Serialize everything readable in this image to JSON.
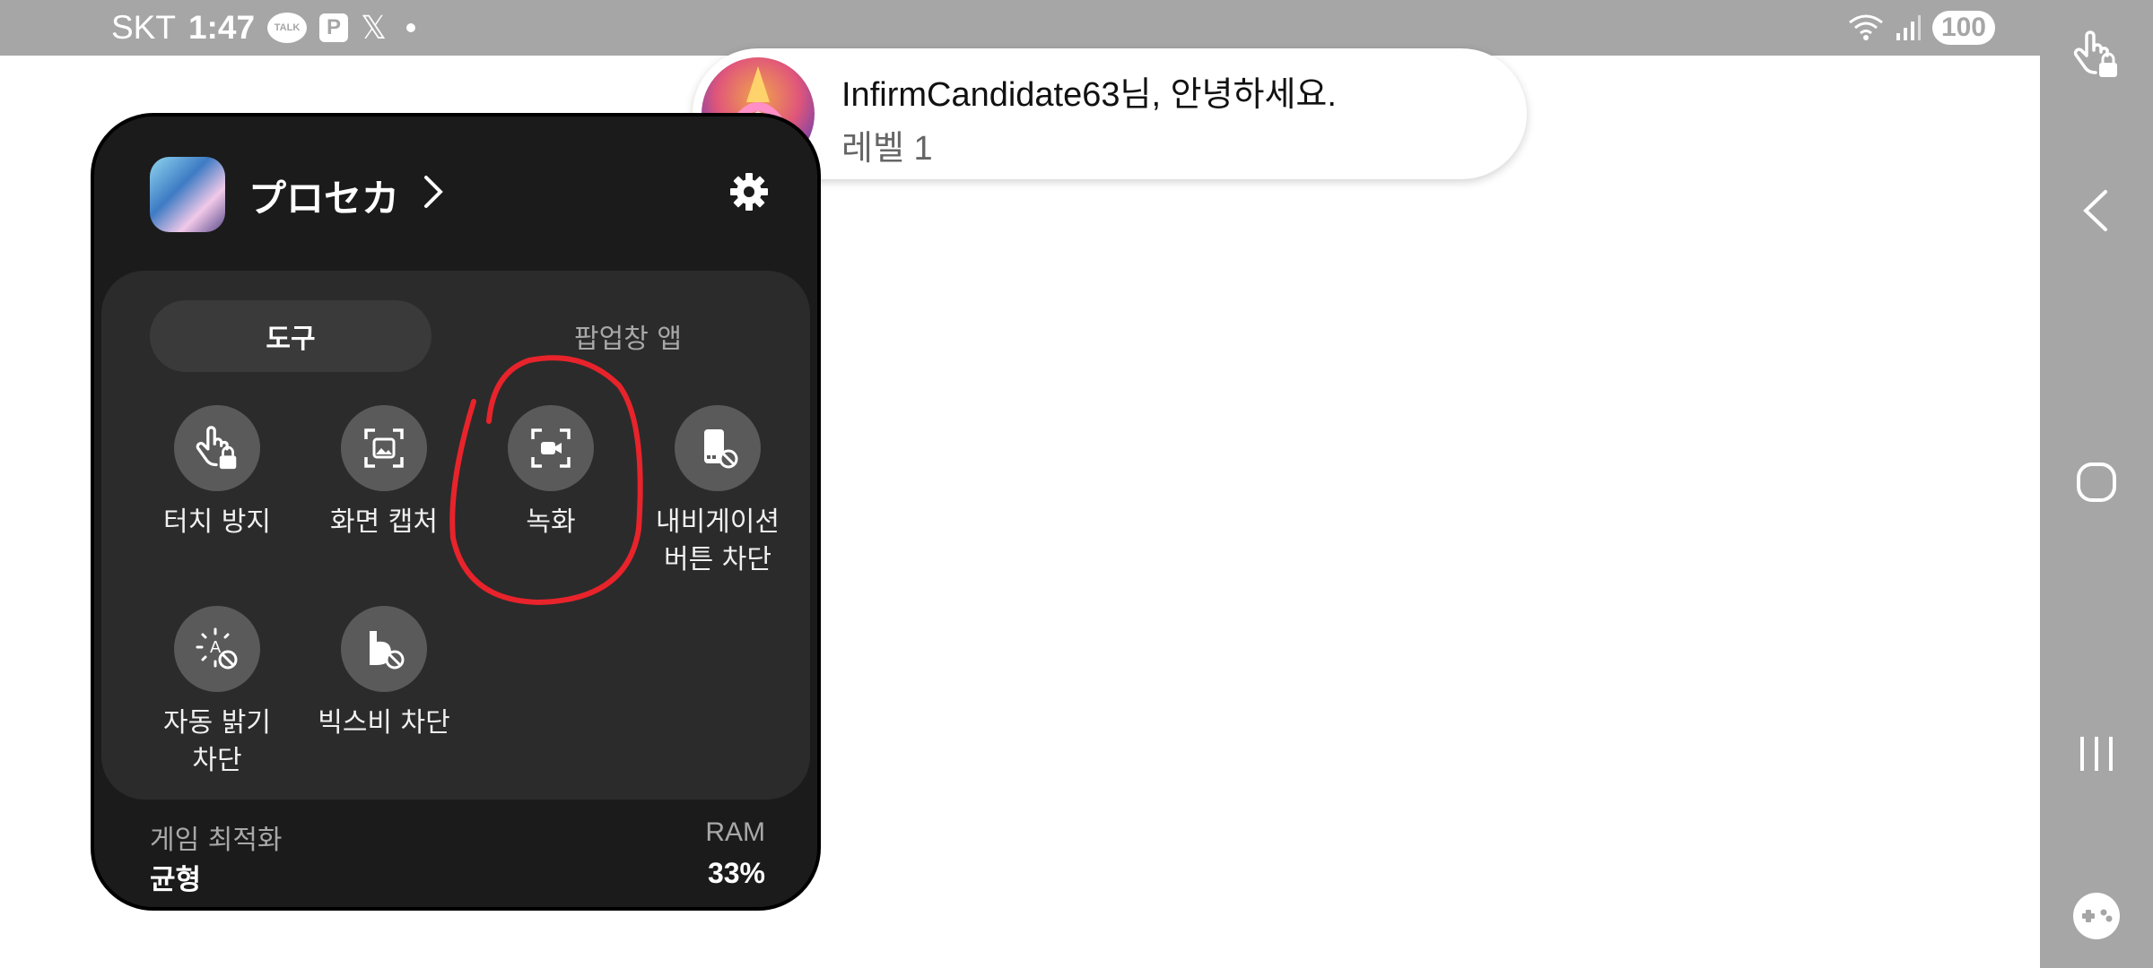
{
  "status_bar": {
    "carrier": "SKT",
    "time": "1:47",
    "talk_icon_text": "TALK",
    "p_icon_text": "P",
    "x_icon_text": "𝕏",
    "battery": "100"
  },
  "greeting": {
    "name_line": "InfirmCandidate63님, 안녕하세요.",
    "level_line": "레벨 1"
  },
  "panel": {
    "game_title": "プロセカ",
    "tabs": [
      {
        "label": "도구",
        "selected": true
      },
      {
        "label": "팝업창 앱",
        "selected": false
      }
    ],
    "tools": [
      {
        "label": "터치 방지",
        "icon": "touch-lock-icon"
      },
      {
        "label": "화면 캡처",
        "icon": "screenshot-icon"
      },
      {
        "label": "녹화",
        "icon": "record-video-icon",
        "annotated": true
      },
      {
        "label": "내비게이션\n버튼 차단",
        "icon": "block-navigation-icon"
      },
      {
        "label": "자동 밝기\n차단",
        "icon": "block-auto-brightness-icon"
      },
      {
        "label": "빅스비 차단",
        "icon": "block-bixby-icon"
      }
    ],
    "footer": {
      "optimization_label": "게임 최적화",
      "optimization_value": "균형",
      "ram_label": "RAM",
      "ram_value": "33%"
    }
  },
  "colors": {
    "status_bar": "#a6a6a6",
    "panel_bg": "#1b1b1b",
    "inner_bg": "#2b2b2b",
    "annotation": "#e8232b"
  }
}
